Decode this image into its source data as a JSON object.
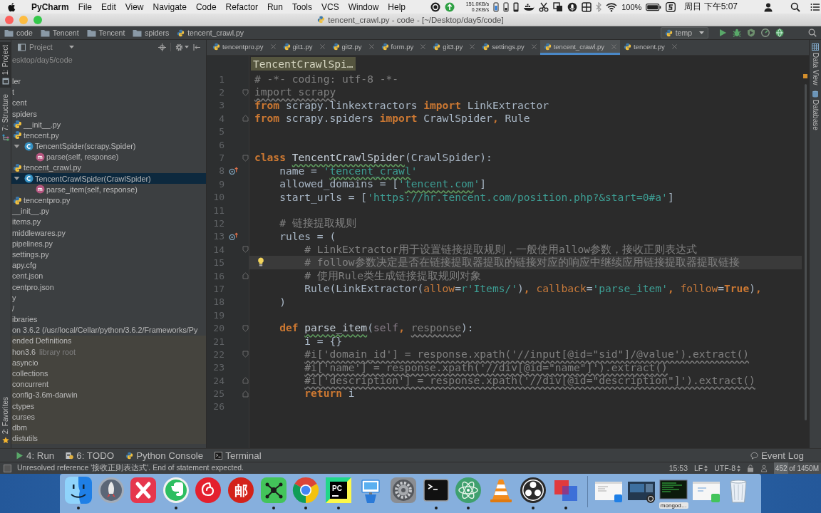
{
  "menu_bar": {
    "app_name": "PyCharm",
    "menus": [
      "File",
      "Edit",
      "View",
      "Navigate",
      "Code",
      "Refactor",
      "Run",
      "Tools",
      "VCS",
      "Window",
      "Help"
    ],
    "upload_speed": "151.0KB/s",
    "download_speed": "0.2KB/s",
    "battery": "100%",
    "clock": "周日 下午5:07"
  },
  "window": {
    "title": "tencent_crawl.py - code - [~/Desktop/day5/code]"
  },
  "nav_bar": {
    "crumbs": [
      {
        "label": "code",
        "kind": "folder"
      },
      {
        "label": "Tencent",
        "kind": "folder"
      },
      {
        "label": "Tencent",
        "kind": "folder"
      },
      {
        "label": "spiders",
        "kind": "folder"
      },
      {
        "label": "tencent_crawl.py",
        "kind": "python-file"
      }
    ],
    "run_config": "temp"
  },
  "left_stripe": [
    {
      "label": "1: Project",
      "kind": "project",
      "selected": true
    },
    {
      "label": "7: Structure",
      "kind": "structure",
      "selected": false
    },
    {
      "label": "2: Favorites",
      "kind": "favorites",
      "selected": false
    }
  ],
  "project_panel": {
    "title": "Project",
    "root_path": "esktop/day5/code",
    "tree": [
      {
        "label": "ler",
        "kind": "plain",
        "selected": false
      },
      {
        "label": "t",
        "kind": "plain",
        "selected": false
      },
      {
        "label": "cent",
        "kind": "plain",
        "selected": false
      },
      {
        "label": "spiders",
        "kind": "plain",
        "selected": false,
        "children": [
          {
            "label": "__init__.py",
            "kind": "python-file",
            "selected": false
          },
          {
            "label": "tencent.py",
            "kind": "python-file",
            "selected": false,
            "children": [
              {
                "label": "TencentSpider(scrapy.Spider)",
                "kind": "class",
                "expanded": true,
                "selected": false,
                "children": [
                  {
                    "label": "parse(self, response)",
                    "kind": "method",
                    "selected": false
                  }
                ]
              }
            ]
          },
          {
            "label": "tencent_crawl.py",
            "kind": "python-file",
            "selected": false,
            "children": [
              {
                "label": "TencentCrawlSpider(CrawlSpider)",
                "kind": "class",
                "expanded": true,
                "selected": true,
                "children": [
                  {
                    "label": "parse_item(self, response)",
                    "kind": "method",
                    "selected": false
                  }
                ]
              }
            ]
          },
          {
            "label": "tencentpro.py",
            "kind": "python-file",
            "selected": false
          }
        ]
      },
      {
        "label": "__init__.py",
        "kind": "plain",
        "selected": false
      },
      {
        "label": "items.py",
        "kind": "plain",
        "selected": false
      },
      {
        "label": "middlewares.py",
        "kind": "plain",
        "selected": false
      },
      {
        "label": "pipelines.py",
        "kind": "plain",
        "selected": false
      },
      {
        "label": "settings.py",
        "kind": "plain",
        "selected": false
      },
      {
        "label": "apy.cfg",
        "kind": "plain",
        "selected": false
      },
      {
        "label": "cent.json",
        "kind": "plain",
        "selected": false
      },
      {
        "label": "centpro.json",
        "kind": "plain",
        "selected": false
      },
      {
        "label": "y",
        "kind": "plain",
        "selected": false
      },
      {
        "label": "/",
        "kind": "plain",
        "selected": false
      },
      {
        "label": "ibraries",
        "kind": "plain",
        "selected": false
      },
      {
        "label": "on 3.6.2 (/usr/local/Cellar/python/3.6.2/Frameworks/Py",
        "kind": "plain",
        "selected": false
      },
      {
        "label": "ended Definitions",
        "kind": "library",
        "selected": false
      },
      {
        "label": "hon3.6",
        "hint": "library root",
        "kind": "library",
        "selected": false
      },
      {
        "label": "asyncio",
        "kind": "library",
        "selected": false
      },
      {
        "label": "collections",
        "kind": "library",
        "selected": false
      },
      {
        "label": "concurrent",
        "kind": "library",
        "selected": false
      },
      {
        "label": "config-3.6m-darwin",
        "kind": "library",
        "selected": false
      },
      {
        "label": "ctypes",
        "kind": "library",
        "selected": false
      },
      {
        "label": "curses",
        "kind": "library",
        "selected": false
      },
      {
        "label": "dbm",
        "kind": "library",
        "selected": false
      },
      {
        "label": "distutils",
        "kind": "library",
        "selected": false
      }
    ]
  },
  "editor": {
    "tabs": [
      {
        "label": "tencentpro.py",
        "selected": false
      },
      {
        "label": "git1.py",
        "selected": false
      },
      {
        "label": "git2.py",
        "selected": false
      },
      {
        "label": "form.py",
        "selected": false
      },
      {
        "label": "git3.py",
        "selected": false
      },
      {
        "label": "settings.py",
        "selected": false
      },
      {
        "label": "tencent_crawl.py",
        "selected": true
      },
      {
        "label": "tencent.py",
        "selected": false
      }
    ],
    "breadcrumb_hint": "TencentCrawlSpi…",
    "lines": [
      {
        "number": "1",
        "current": false,
        "segments": [
          {
            "text": "# -*- coding: utf-8 -*-",
            "kind": "comment"
          }
        ]
      },
      {
        "number": "2",
        "current": false,
        "markers": [
          {
            "kind": "fold-start"
          }
        ],
        "segments": [
          {
            "text": "import scrapy",
            "kind": "unused"
          }
        ]
      },
      {
        "number": "3",
        "current": false,
        "segments": [
          {
            "text": "from",
            "kind": "keyword"
          },
          {
            "text": " scrapy.linkextractors ",
            "kind": "text"
          },
          {
            "text": "import",
            "kind": "keyword"
          },
          {
            "text": " LinkExtractor",
            "kind": "text"
          }
        ]
      },
      {
        "number": "4",
        "current": false,
        "markers": [
          {
            "kind": "fold-end"
          }
        ],
        "segments": [
          {
            "text": "from",
            "kind": "keyword"
          },
          {
            "text": " scrapy.spiders ",
            "kind": "text"
          },
          {
            "text": "import",
            "kind": "keyword"
          },
          {
            "text": " CrawlSpider",
            "kind": "text"
          },
          {
            "text": ",",
            "kind": "keyword"
          },
          {
            "text": " Rule",
            "kind": "text"
          }
        ]
      },
      {
        "number": "5",
        "current": false
      },
      {
        "number": "6",
        "current": false
      },
      {
        "number": "7",
        "current": false,
        "markers": [
          {
            "kind": "fold-start"
          }
        ],
        "segments": [
          {
            "text": "class ",
            "kind": "keyword"
          },
          {
            "text": "TencentCrawlSpider",
            "kind": "name-typo"
          },
          {
            "text": "(CrawlSpider):",
            "kind": "text"
          }
        ]
      },
      {
        "number": "8",
        "current": false,
        "markers": [
          {
            "kind": "override"
          }
        ],
        "segments": [
          {
            "text": "    name = ",
            "kind": "text"
          },
          {
            "text": "'",
            "kind": "string"
          },
          {
            "text": "tencent_crawl",
            "kind": "string-typo"
          },
          {
            "text": "'",
            "kind": "string"
          }
        ]
      },
      {
        "number": "9",
        "current": false,
        "segments": [
          {
            "text": "    allowed_domains = [",
            "kind": "text"
          },
          {
            "text": "'",
            "kind": "string"
          },
          {
            "text": "tencent.com",
            "kind": "string-typo"
          },
          {
            "text": "'",
            "kind": "string"
          },
          {
            "text": "]",
            "kind": "text"
          }
        ]
      },
      {
        "number": "10",
        "current": false,
        "segments": [
          {
            "text": "    start_urls = [",
            "kind": "text"
          },
          {
            "text": "'https://hr.tencent.com/position.php?&start=0#a'",
            "kind": "string"
          },
          {
            "text": "]",
            "kind": "text"
          }
        ]
      },
      {
        "number": "11",
        "current": false
      },
      {
        "number": "12",
        "current": false,
        "segments": [
          {
            "text": "    # 链接提取规则",
            "kind": "comment"
          }
        ]
      },
      {
        "number": "13",
        "current": false,
        "markers": [
          {
            "kind": "override"
          }
        ],
        "segments": [
          {
            "text": "    rules = (",
            "kind": "text"
          }
        ]
      },
      {
        "number": "14",
        "current": false,
        "markers": [
          {
            "kind": "fold-start"
          }
        ],
        "segments": [
          {
            "text": "        # LinkExtractor用于设置链接提取规则，一般使用allow参数，接收正则表达式",
            "kind": "comment"
          }
        ]
      },
      {
        "number": "15",
        "current": true,
        "markers": [
          {
            "kind": "bulb"
          }
        ],
        "segments": [
          {
            "text": "        # follow参数决定是否在链接提取器提取的链接对应的响应中继续应用链接提取器提取链接",
            "kind": "comment"
          }
        ]
      },
      {
        "number": "16",
        "current": false,
        "markers": [
          {
            "kind": "fold-end"
          }
        ],
        "segments": [
          {
            "text": "        # 使用Rule类生成链接提取规则对象",
            "kind": "comment"
          }
        ]
      },
      {
        "number": "17",
        "current": false,
        "segments": [
          {
            "text": "        Rule(LinkExtractor(",
            "kind": "text"
          },
          {
            "text": "allow",
            "kind": "named-arg"
          },
          {
            "text": "=",
            "kind": "text"
          },
          {
            "text": "r'Items/'",
            "kind": "string"
          },
          {
            "text": ")",
            "kind": "text"
          },
          {
            "text": ", ",
            "kind": "keyword"
          },
          {
            "text": "callback",
            "kind": "named-arg"
          },
          {
            "text": "=",
            "kind": "text"
          },
          {
            "text": "'parse_item'",
            "kind": "string"
          },
          {
            "text": ", ",
            "kind": "keyword"
          },
          {
            "text": "follow",
            "kind": "named-arg"
          },
          {
            "text": "=",
            "kind": "text"
          },
          {
            "text": "True",
            "kind": "keyword"
          },
          {
            "text": ")",
            "kind": "text"
          },
          {
            "text": ",",
            "kind": "keyword"
          }
        ]
      },
      {
        "number": "18",
        "current": false,
        "segments": [
          {
            "text": "    )",
            "kind": "text"
          }
        ]
      },
      {
        "number": "19",
        "current": false
      },
      {
        "number": "20",
        "current": false,
        "markers": [
          {
            "kind": "fold-start"
          }
        ],
        "segments": [
          {
            "text": "    def ",
            "kind": "keyword"
          },
          {
            "text": "parse_item",
            "kind": "name-typo"
          },
          {
            "text": "(",
            "kind": "text"
          },
          {
            "text": "self",
            "kind": "self"
          },
          {
            "text": ", ",
            "kind": "keyword"
          },
          {
            "text": "response",
            "kind": "unused"
          },
          {
            "text": "):",
            "kind": "text"
          }
        ]
      },
      {
        "number": "21",
        "current": false,
        "segments": [
          {
            "text": "        i = {}",
            "kind": "text"
          }
        ]
      },
      {
        "number": "22",
        "current": false,
        "markers": [
          {
            "kind": "fold-start"
          }
        ],
        "segments": [
          {
            "text": "        #i['domain_id'] = response.xpath('//input[@id=\"sid\"]/@value').extract()",
            "kind": "unused"
          }
        ]
      },
      {
        "number": "23",
        "current": false,
        "segments": [
          {
            "text": "        #i['name'] = response.xpath('//div[@id=\"name\"]').extract()",
            "kind": "unused"
          }
        ]
      },
      {
        "number": "24",
        "current": false,
        "markers": [
          {
            "kind": "fold-end"
          }
        ],
        "segments": [
          {
            "text": "        #i['description'] = response.xpath('//div[@id=\"description\"]').extract()",
            "kind": "unused"
          }
        ]
      },
      {
        "number": "25",
        "current": false,
        "markers": [
          {
            "kind": "fold-end"
          }
        ],
        "segments": [
          {
            "text": "        return",
            "kind": "keyword"
          },
          {
            "text": " i",
            "kind": "text"
          }
        ]
      },
      {
        "number": "26",
        "current": false
      }
    ]
  },
  "right_stripe": [
    {
      "label": "Data View",
      "kind": "data-view"
    },
    {
      "label": "Database",
      "kind": "database"
    }
  ],
  "tool_windows": [
    {
      "label": "4: Run",
      "kind": "run"
    },
    {
      "label": "6: TODO",
      "kind": "todo"
    },
    {
      "label": "Python Console",
      "kind": "python-console"
    },
    {
      "label": "Terminal",
      "kind": "terminal"
    }
  ],
  "event_log": "Event Log",
  "status_bar": {
    "message": "Unresolved reference '接收正则表达式'. End of statement expected.",
    "position": "15:53",
    "line_separator": "LF",
    "encoding": "UTF-8",
    "memory": {
      "text": "452 of 1450M",
      "level": 0.31
    }
  },
  "dock": {
    "apps": [
      {
        "kind": "face",
        "running": true
      },
      {
        "kind": "rocket",
        "running": false
      },
      {
        "kind": "x-mark",
        "running": false
      },
      {
        "kind": "elephant",
        "running": true
      },
      {
        "kind": "music",
        "running": false
      },
      {
        "kind": "mail",
        "glyph": "邮",
        "running": false
      },
      {
        "kind": "node-graph",
        "running": true
      },
      {
        "kind": "browser",
        "running": true
      },
      {
        "kind": "ide",
        "glyph": "PC",
        "running": true
      },
      {
        "kind": "podium",
        "running": false
      },
      {
        "kind": "gear",
        "running": false
      },
      {
        "kind": "terminal",
        "running": true
      },
      {
        "kind": "atom",
        "running": true
      },
      {
        "kind": "cone",
        "running": false
      },
      {
        "kind": "ring",
        "running": true
      },
      {
        "kind": "double-square",
        "running": true
      }
    ],
    "windows": [
      {
        "kind": "light-window"
      },
      {
        "kind": "dark-window"
      },
      {
        "kind": "terminal-window",
        "label": "mongod…"
      },
      {
        "kind": "green-badge-window"
      }
    ]
  }
}
